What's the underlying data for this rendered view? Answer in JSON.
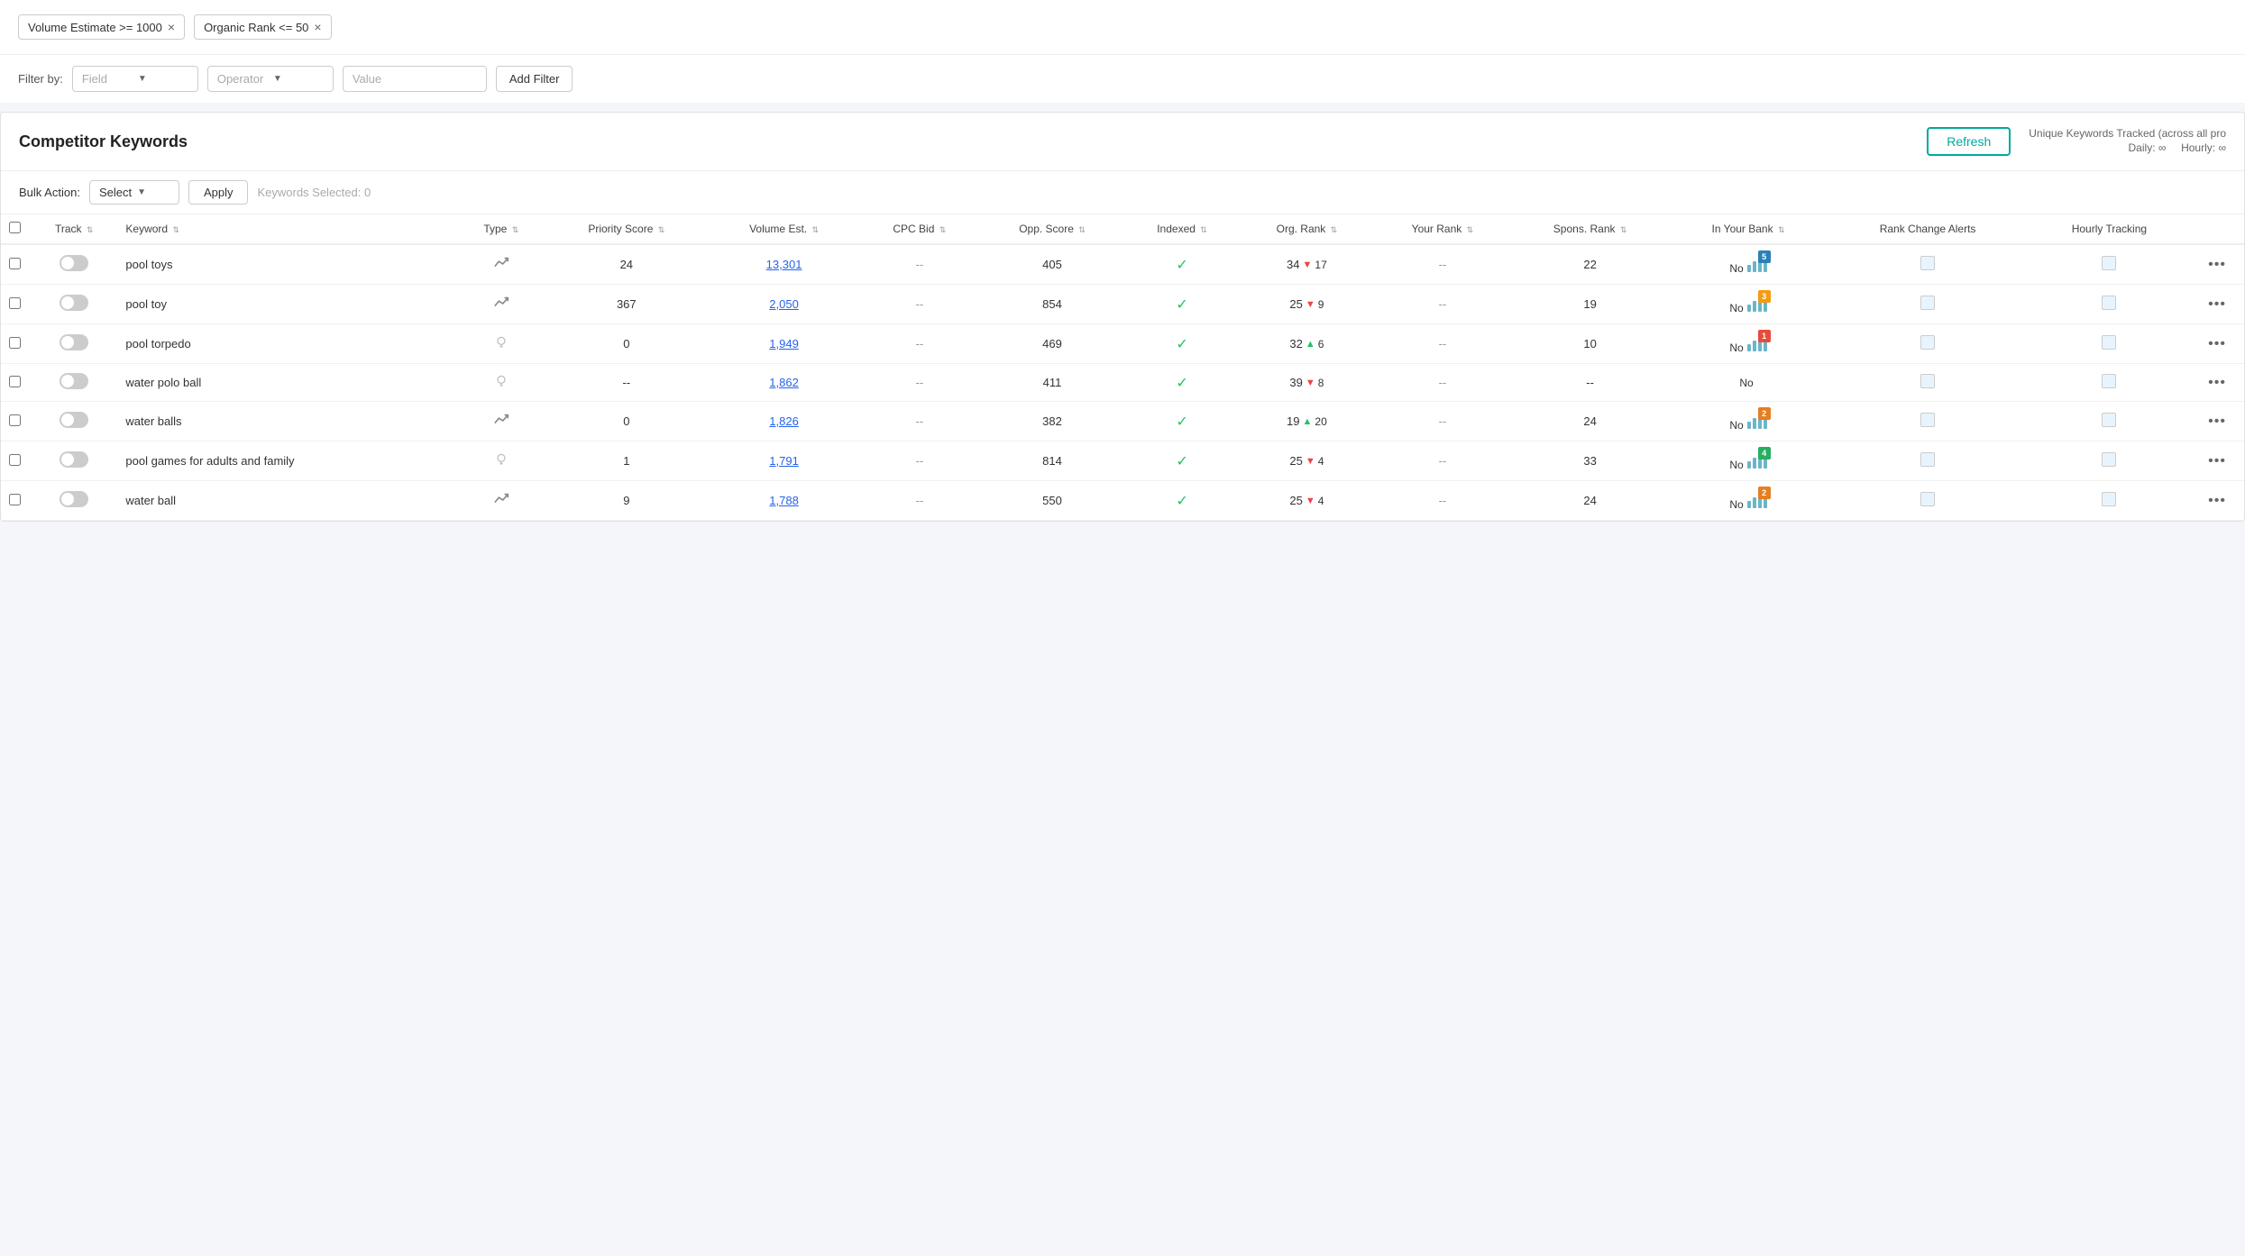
{
  "filters": {
    "chips": [
      {
        "id": "chip-volume",
        "label": "Volume Estimate >= 1000"
      },
      {
        "id": "chip-rank",
        "label": "Organic Rank <= 50"
      }
    ],
    "field_placeholder": "Field",
    "operator_placeholder": "Operator",
    "value_placeholder": "Value",
    "add_filter_label": "Add Filter"
  },
  "table": {
    "title": "Competitor Keywords",
    "refresh_label": "Refresh",
    "unique_keywords_label": "Unique Keywords Tracked (across all pro",
    "daily_label": "Daily: ∞",
    "hourly_label": "Hourly: ∞",
    "bulk_action_label": "Bulk Action:",
    "select_label": "Select",
    "apply_label": "Apply",
    "keywords_selected": "Keywords Selected: 0",
    "columns": {
      "track": "Track",
      "keyword": "Keyword",
      "type": "Type",
      "priority_score": "Priority Score",
      "volume_est": "Volume Est.",
      "cpc_bid": "CPC Bid",
      "opp_score": "Opp. Score",
      "indexed": "Indexed",
      "org_rank": "Org. Rank",
      "your_rank": "Your Rank",
      "spons_rank": "Spons. Rank",
      "in_your_bank": "In Your Bank",
      "rank_change_alerts": "Rank Change Alerts",
      "hourly_tracking": "Hourly Tracking"
    },
    "rows": [
      {
        "keyword": "pool toys",
        "type": "trend",
        "priority_score": "24",
        "volume_est": "13,301",
        "cpc_bid": "--",
        "opp_score": "405",
        "indexed": true,
        "org_rank": "34",
        "org_rank_change": "-17",
        "org_rank_dir": "down",
        "your_rank": "--",
        "spons_rank": "22",
        "bar_badge": "5",
        "in_bank": "No",
        "rank_alert": false,
        "hourly": false
      },
      {
        "keyword": "pool toy",
        "type": "trend",
        "priority_score": "367",
        "volume_est": "2,050",
        "cpc_bid": "--",
        "opp_score": "854",
        "indexed": true,
        "org_rank": "25",
        "org_rank_change": "-9",
        "org_rank_dir": "down",
        "your_rank": "--",
        "spons_rank": "19",
        "bar_badge": "3",
        "in_bank": "No",
        "rank_alert": false,
        "hourly": false
      },
      {
        "keyword": "pool torpedo",
        "type": "bulb",
        "priority_score": "0",
        "volume_est": "1,949",
        "cpc_bid": "--",
        "opp_score": "469",
        "indexed": true,
        "org_rank": "32",
        "org_rank_change": "+6",
        "org_rank_dir": "up",
        "your_rank": "--",
        "spons_rank": "10",
        "bar_badge": "1",
        "in_bank": "No",
        "rank_alert": false,
        "hourly": false
      },
      {
        "keyword": "water polo ball",
        "type": "bulb",
        "priority_score": "--",
        "volume_est": "1,862",
        "cpc_bid": "--",
        "opp_score": "411",
        "indexed": true,
        "org_rank": "39",
        "org_rank_change": "-8",
        "org_rank_dir": "down",
        "your_rank": "--",
        "spons_rank": "--",
        "bar_badge": null,
        "in_bank": "No",
        "rank_alert": false,
        "hourly": false
      },
      {
        "keyword": "water balls",
        "type": "trend",
        "priority_score": "0",
        "volume_est": "1,826",
        "cpc_bid": "--",
        "opp_score": "382",
        "indexed": true,
        "org_rank": "19",
        "org_rank_change": "+20",
        "org_rank_dir": "up",
        "your_rank": "--",
        "spons_rank": "24",
        "bar_badge": "2",
        "in_bank": "No",
        "rank_alert": false,
        "hourly": false
      },
      {
        "keyword": "pool games for adults and family",
        "type": "bulb",
        "priority_score": "1",
        "volume_est": "1,791",
        "cpc_bid": "--",
        "opp_score": "814",
        "indexed": true,
        "org_rank": "25",
        "org_rank_change": "-4",
        "org_rank_dir": "down",
        "your_rank": "--",
        "spons_rank": "33",
        "bar_badge": "4",
        "in_bank": "No",
        "rank_alert": false,
        "hourly": false
      },
      {
        "keyword": "water ball",
        "type": "trend",
        "priority_score": "9",
        "volume_est": "1,788",
        "cpc_bid": "--",
        "opp_score": "550",
        "indexed": true,
        "org_rank": "25",
        "org_rank_change": "-4",
        "org_rank_dir": "down",
        "your_rank": "--",
        "spons_rank": "24",
        "bar_badge": "2",
        "in_bank": "No",
        "rank_alert": false,
        "hourly": false
      }
    ]
  },
  "colors": {
    "accent": "#00a99d",
    "link": "#2563eb",
    "green_check": "#22c55e",
    "red_arrow": "#ef4444",
    "green_arrow": "#22c55e"
  }
}
